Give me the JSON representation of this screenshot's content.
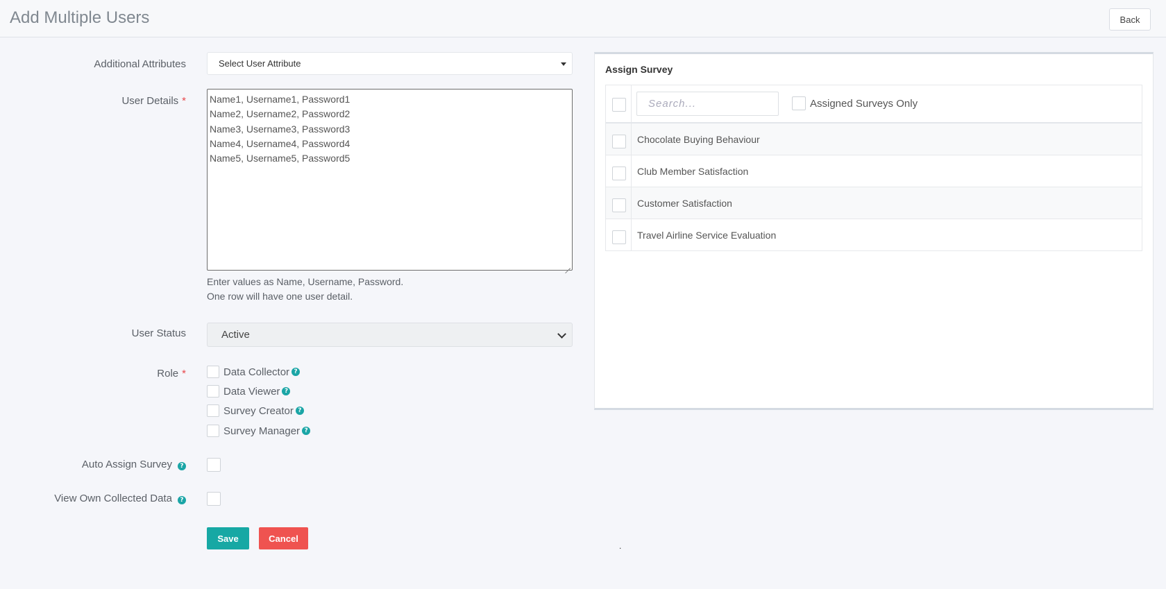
{
  "header": {
    "title": "Add Multiple Users",
    "back_label": "Back"
  },
  "form": {
    "additional_attributes": {
      "label": "Additional Attributes",
      "value": "Select User Attribute"
    },
    "user_details": {
      "label": "User Details",
      "required_mark": "*",
      "lines": [
        "Name1, Username1, Password1",
        "Name2, Username2, Password2",
        "Name3, Username3, Password3",
        "Name4, Username4, Password4",
        "Name5, Username5, Password5"
      ],
      "help_line1": "Enter values as Name, Username, Password.",
      "help_line2": "One row will have one user detail."
    },
    "user_status": {
      "label": "User Status",
      "value": "Active"
    },
    "role": {
      "label": "Role",
      "required_mark": "*",
      "options": [
        "Data Collector",
        "Data Viewer",
        "Survey Creator",
        "Survey Manager"
      ]
    },
    "auto_assign_survey": {
      "label": "Auto Assign Survey"
    },
    "view_own_collected_data": {
      "label": "View Own Collected Data"
    },
    "save_label": "Save",
    "cancel_label": "Cancel",
    "stray_mark": "."
  },
  "assign_survey": {
    "title": "Assign Survey",
    "search_placeholder": "Search...",
    "assigned_only_label": "Assigned Surveys Only",
    "surveys": [
      "Chocolate Buying Behaviour",
      "Club Member Satisfaction",
      "Customer Satisfaction",
      "Travel Airline Service Evaluation"
    ]
  },
  "icons": {
    "help": "question-circle-icon",
    "dropdown": "caret-down-icon"
  },
  "colors": {
    "primary": "#17a8a4",
    "danger": "#ef5350",
    "required": "#e8474b",
    "help_icon": "#1aa5a6"
  }
}
